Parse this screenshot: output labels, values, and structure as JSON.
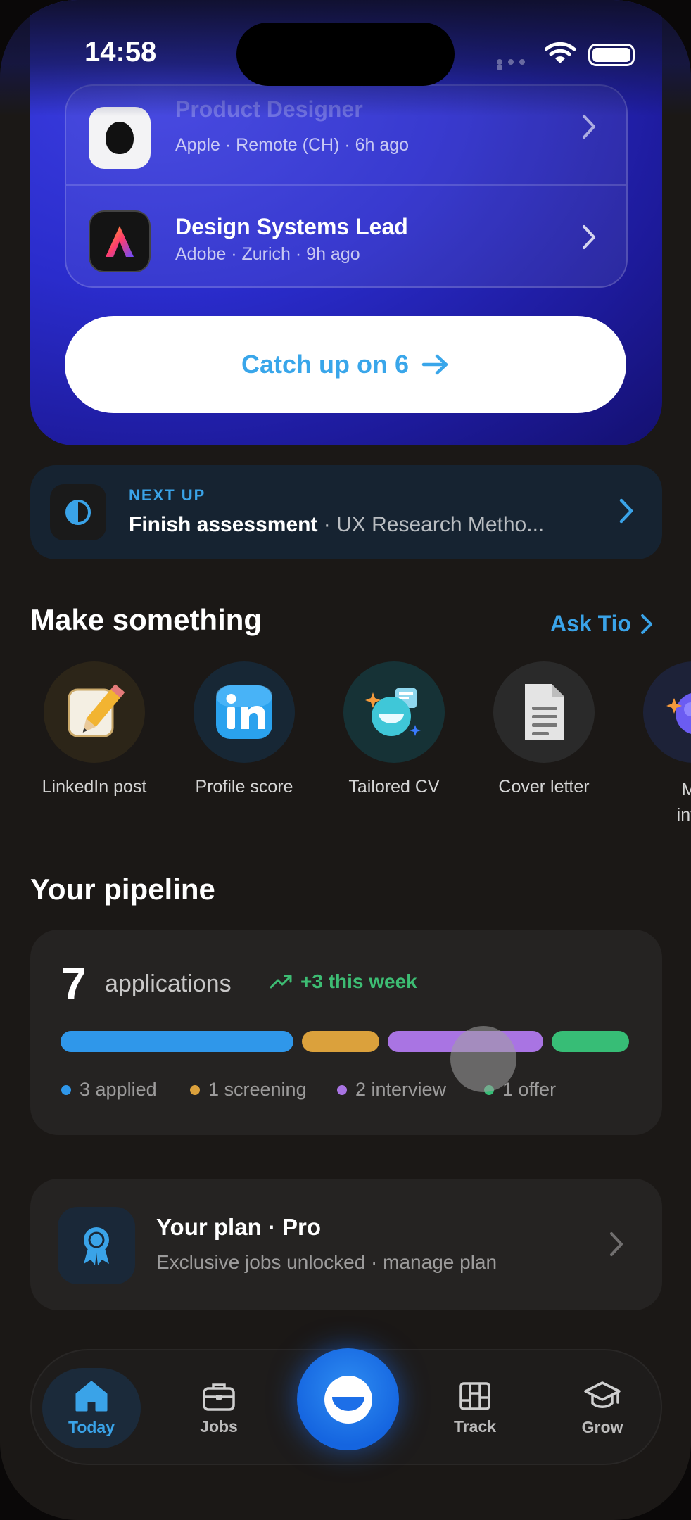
{
  "status_bar": {
    "time": "14:58"
  },
  "recent_jobs": [
    {
      "title": "Product Designer",
      "company": "Apple",
      "location": "Remote (CH)",
      "age": "6h ago",
      "meta": "Apple · Remote (CH) · 6h ago",
      "logo": "apple-logo"
    },
    {
      "title": "Design Systems Lead",
      "company": "Adobe",
      "location": "Zurich",
      "age": "9h ago",
      "meta": "Adobe · Zurich · 9h ago",
      "logo": "adobe-logo"
    }
  ],
  "catch_up": {
    "label": "Catch up on 6"
  },
  "next_up": {
    "kicker": "NEXT UP",
    "action": "Finish assessment",
    "separator": " · ",
    "detail": "UX Research Metho..."
  },
  "make_something": {
    "title": "Make something",
    "ask_link": "Ask Tio",
    "tools": [
      {
        "label": "LinkedIn post",
        "icon": "pencil-icon"
      },
      {
        "label": "Profile score",
        "icon": "linkedin-icon"
      },
      {
        "label": "Tailored CV",
        "icon": "cv-sparkle-icon"
      },
      {
        "label": "Cover letter",
        "icon": "document-icon"
      },
      {
        "label": "Mo",
        "label2": "inter",
        "icon": "interview-icon"
      }
    ]
  },
  "pipeline": {
    "title": "Your pipeline",
    "count": "7",
    "count_label": "applications",
    "delta": "+3 this week",
    "stages": [
      {
        "label": "3 applied",
        "value": 3,
        "color": "#2f97ea"
      },
      {
        "label": "1 screening",
        "value": 1,
        "color": "#dba13c"
      },
      {
        "label": "2 interview",
        "value": 2,
        "color": "#a974e3"
      },
      {
        "label": "1 offer",
        "value": 1,
        "color": "#37bd76"
      }
    ]
  },
  "plan": {
    "title": "Your plan · Pro",
    "subtitle": "Exclusive jobs unlocked · manage plan"
  },
  "tabbar": {
    "tabs": [
      {
        "label": "Today",
        "icon": "home-icon",
        "active": true
      },
      {
        "label": "Jobs",
        "icon": "briefcase-icon"
      },
      {
        "label": "Track",
        "icon": "board-icon"
      },
      {
        "label": "Grow",
        "icon": "graduation-cap-icon"
      }
    ],
    "center_icon": "assistant-smile-icon"
  },
  "colors": {
    "accent": "#3aa3e8",
    "hero_gradient_start": "#3b3ee0",
    "hero_gradient_end": "#141070",
    "positive": "#3dbc73"
  }
}
